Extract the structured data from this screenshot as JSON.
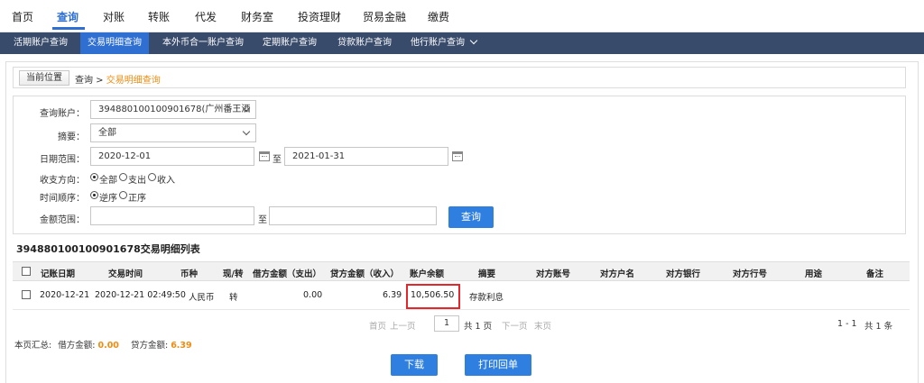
{
  "topnav": {
    "items": [
      "首页",
      "查询",
      "对账",
      "转账",
      "代发",
      "财务室",
      "投资理财",
      "贸易金融",
      "缴费"
    ],
    "active_index": 1
  },
  "subnav": {
    "items": [
      "活期账户查询",
      "交易明细查询",
      "本外币合一账户查询",
      "定期账户查询",
      "贷款账户查询",
      "他行账户查询"
    ],
    "active_index": 1
  },
  "breadcrumb": {
    "tag": "当前位置",
    "parent": "查询",
    "sep": " > ",
    "current": "交易明细查询"
  },
  "form": {
    "account_label": "查询账户：",
    "account_value": "394880100100901678(广州番王酒",
    "summary_label": "摘要：",
    "summary_value": "全部",
    "date_label": "日期范围：",
    "date_from": "2020-12-01",
    "date_to_sep": "至",
    "date_to": "2021-01-31",
    "direction_label": "收支方向：",
    "direction_options": [
      "全部",
      "支出",
      "收入"
    ],
    "order_label": "时间顺序：",
    "order_options": [
      "逆序",
      "正序"
    ],
    "amount_label": "金额范围：",
    "amount_from": "",
    "amount_sep": "至",
    "amount_to": "",
    "query_button": "查询"
  },
  "list": {
    "title": "394880100100901678交易明细列表",
    "columns": [
      "记账日期",
      "交易时间",
      "币种",
      "现/转",
      "借方金额（支出）",
      "贷方金额（收入）",
      "账户余额",
      "摘要",
      "对方账号",
      "对方户名",
      "对方银行",
      "对方行号",
      "用途",
      "备注"
    ],
    "rows": [
      {
        "date": "2020-12-21",
        "time": "2020-12-21 02:49:50",
        "currency": "人民币",
        "cash_transfer": "转",
        "debit": "0.00",
        "credit": "6.39",
        "balance": "10,506.50",
        "summary": "存款利息"
      }
    ]
  },
  "pager": {
    "first": "首页",
    "prev": "上一页",
    "page": "1",
    "total_pages": "共 1 页",
    "next": "下一页",
    "last": "末页",
    "range": "1 - 1",
    "total_count": "共 1 条"
  },
  "page_summary": {
    "label": "本页汇总:",
    "debit_label": "借方金额:",
    "debit_value": "0.00",
    "credit_label": "贷方金额:",
    "credit_value": "6.39"
  },
  "actions": {
    "download": "下载",
    "print_receipt": "打印回单"
  },
  "colors": {
    "accent": "#2f7fe0",
    "subnav_bg": "#394b6b",
    "breadcrumb_current": "#f08c12",
    "highlight_box": "#e5262b"
  }
}
